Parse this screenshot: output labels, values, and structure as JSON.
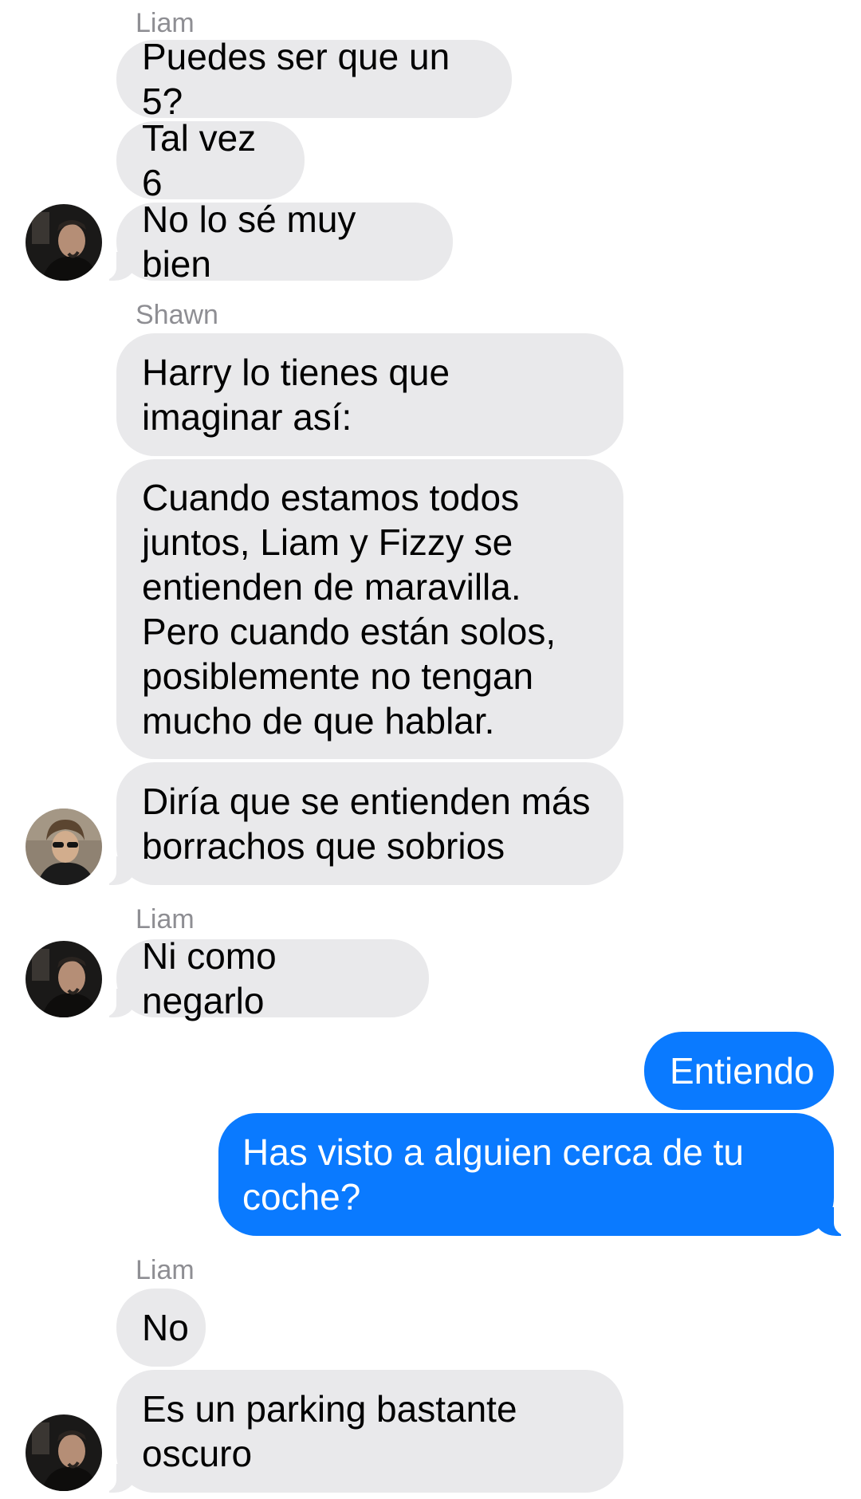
{
  "conversation": {
    "group1": {
      "sender": "Liam",
      "messages": [
        "Puedes ser que un 5?",
        "Tal vez 6",
        "No lo sé muy bien"
      ],
      "avatar_icon": "liam-avatar"
    },
    "group2": {
      "sender": "Shawn",
      "messages": [
        "Harry lo tienes que imaginar así:",
        "Cuando estamos todos juntos, Liam y Fizzy se entienden de maravilla. Pero cuando están solos, posiblemente no tengan mucho de que hablar.",
        "Diría que se entienden más borrachos que sobrios"
      ],
      "avatar_icon": "shawn-avatar"
    },
    "group3": {
      "sender": "Liam",
      "messages": [
        "Ni como negarlo"
      ],
      "avatar_icon": "liam-avatar"
    },
    "outgoing": {
      "messages": [
        "Entiendo",
        "Has visto a alguien cerca de tu coche?"
      ]
    },
    "group4": {
      "sender": "Liam",
      "messages": [
        "No",
        "Es un parking bastante oscuro"
      ],
      "avatar_icon": "liam-avatar"
    }
  },
  "colors": {
    "incoming_bubble": "#e9e9eb",
    "outgoing_bubble": "#0a7aff",
    "sender_label": "#8e8e93"
  }
}
